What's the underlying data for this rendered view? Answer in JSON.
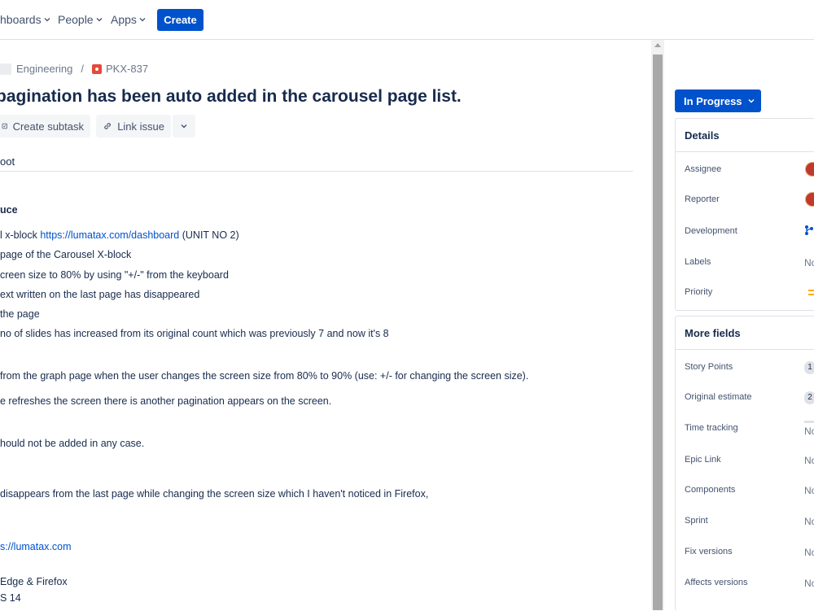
{
  "topnav": {
    "dashboards": "hboards",
    "people": "People",
    "apps": "Apps",
    "create": "Create"
  },
  "breadcrumb": {
    "project": "Engineering",
    "separator": "/",
    "issue_key": "PKX-837"
  },
  "issue": {
    "title": "pagination has been auto added in the carousel page list.",
    "actions": {
      "create_subtask": "Create subtask",
      "link_issue": "Link issue"
    },
    "tab": "oot"
  },
  "description": {
    "steps_heading": "uce",
    "step1_prefix": "l x-block ",
    "step1_link": "https://lumatax.com/dashboard",
    "step1_suffix": " (UNIT NO 2)",
    "step2": " page of the Carousel X-block",
    "step3": "creen size to 80% by using \"+/-\" from the keyboard",
    "step4": "ext written on the last page has disappeared",
    "step5": "the page",
    "step6": "no of slides has increased from its original count which was previously 7 and now it's 8",
    "actual1": " from the graph page when the user changes the screen size from 80% to 90% (use: +/- for changing the screen size).",
    "actual2": "e refreshes the screen there is another pagination appears on the screen.",
    "expected": "hould not be added in any case.",
    "note": " disappears from the last page while changing the screen size which I haven't noticed in Firefox,",
    "env_link": "s://lumatax.com",
    "browsers": " Edge & Firefox",
    "os": "S 14"
  },
  "sidebar": {
    "status": "In Progress",
    "details": {
      "heading": "Details",
      "assignee_label": "Assignee",
      "reporter_label": "Reporter",
      "development_label": "Development",
      "labels_label": "Labels",
      "labels_value": "No",
      "priority_label": "Priority"
    },
    "more_fields": {
      "heading": "More fields",
      "story_points_label": "Story Points",
      "story_points_value": "1",
      "original_estimate_label": "Original estimate",
      "original_estimate_value": "2",
      "time_tracking_label": "Time tracking",
      "time_tracking_value": "No",
      "epic_link_label": "Epic Link",
      "epic_link_value": "No",
      "components_label": "Components",
      "components_value": "No",
      "sprint_label": "Sprint",
      "sprint_value": "No",
      "fix_versions_label": "Fix versions",
      "fix_versions_value": "No",
      "affects_versions_label": "Affects versions",
      "affects_versions_value": "No"
    }
  },
  "colors": {
    "primary": "#0052cc",
    "text": "#172b4d",
    "subtle": "#42526e",
    "bug": "#e5493a",
    "priority_medium": "#ffab00"
  }
}
